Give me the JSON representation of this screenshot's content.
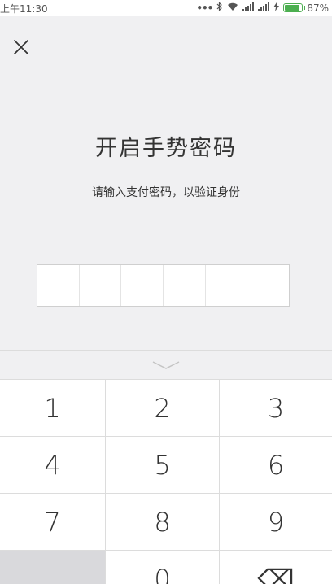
{
  "status_bar": {
    "time": "上午11:30",
    "dots": "•••",
    "battery_text": "87%",
    "battery_level": 0.87,
    "battery_color": "#4caf50"
  },
  "title": "开启手势密码",
  "subtitle": "请输入支付密码，以验证身份",
  "pin_length": 6,
  "keypad": {
    "rows": [
      [
        "1",
        "2",
        "3"
      ],
      [
        "4",
        "5",
        "6"
      ],
      [
        "7",
        "8",
        "9"
      ],
      [
        "",
        "0",
        "⌫"
      ]
    ]
  },
  "colors": {
    "background": "#f0f0f2",
    "keypad_background": "#ffffff",
    "blank_key": "#d9d9dc"
  }
}
